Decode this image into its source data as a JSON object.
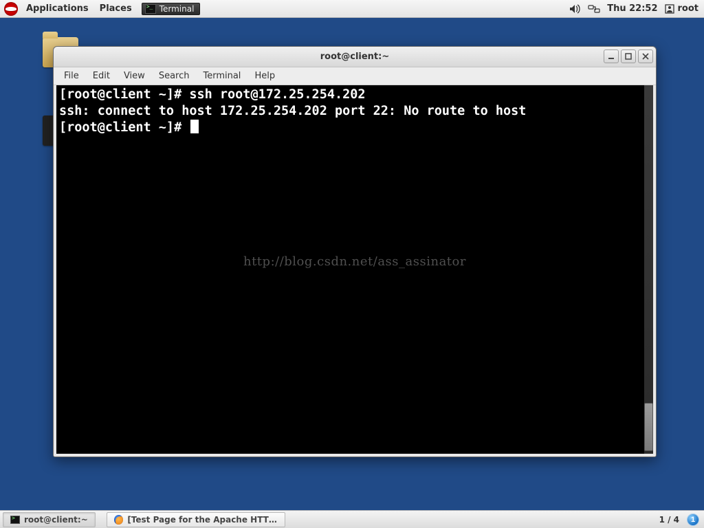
{
  "top_panel": {
    "applications": "Applications",
    "places": "Places",
    "task_label": "Terminal",
    "clock": "Thu 22:52",
    "user": "root"
  },
  "window": {
    "title": "root@client:~",
    "menu": {
      "file": "File",
      "edit": "Edit",
      "view": "View",
      "search": "Search",
      "terminal": "Terminal",
      "help": "Help"
    }
  },
  "terminal": {
    "line1": "[root@client ~]# ssh root@172.25.254.202",
    "line2": "ssh: connect to host 172.25.254.202 port 22: No route to host",
    "line3": "[root@client ~]# "
  },
  "watermark": "http://blog.csdn.net/ass_assinator",
  "bottom_panel": {
    "task1": "root@client:~",
    "task2": "[Test Page for the Apache HTTP...",
    "workspace": "1 / 4",
    "badge": "1"
  }
}
